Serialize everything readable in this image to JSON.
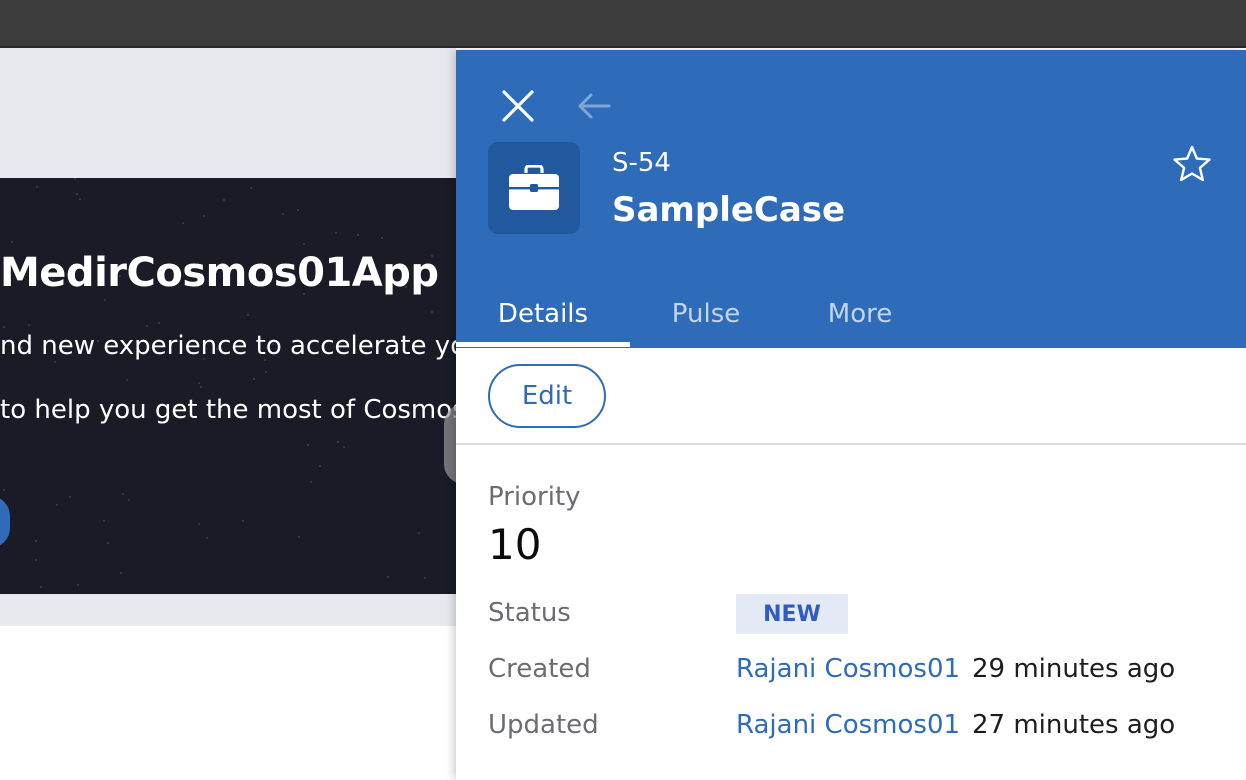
{
  "background_page": {
    "hero_title": "MedirCosmos01App",
    "hero_line1": "nd new experience to accelerate yo",
    "hero_line2": "to help you get the most of Cosmos"
  },
  "case": {
    "id": "S-54",
    "name": "SampleCase",
    "icon": "briefcase-icon"
  },
  "header_icons": {
    "close": "close-icon",
    "back": "arrow-left-icon",
    "favorite": "star-outline-icon"
  },
  "tabs": [
    {
      "label": "Details",
      "active": true
    },
    {
      "label": "Pulse",
      "active": false
    },
    {
      "label": "More",
      "active": false
    }
  ],
  "actions": {
    "edit_label": "Edit"
  },
  "fields": {
    "priority": {
      "label": "Priority",
      "value": "10"
    },
    "status": {
      "label": "Status",
      "value": "NEW"
    },
    "created": {
      "label": "Created",
      "user": "Rajani Cosmos01",
      "time": "29 minutes ago"
    },
    "updated": {
      "label": "Updated",
      "user": "Rajani Cosmos01",
      "time": "27 minutes ago"
    }
  },
  "colors": {
    "header_blue": "#2e6bb8",
    "icon_box": "#22599e",
    "status_badge_bg": "#e4eaf5",
    "status_badge_text": "#2f5cc3",
    "link_blue": "#2e6bb8"
  }
}
